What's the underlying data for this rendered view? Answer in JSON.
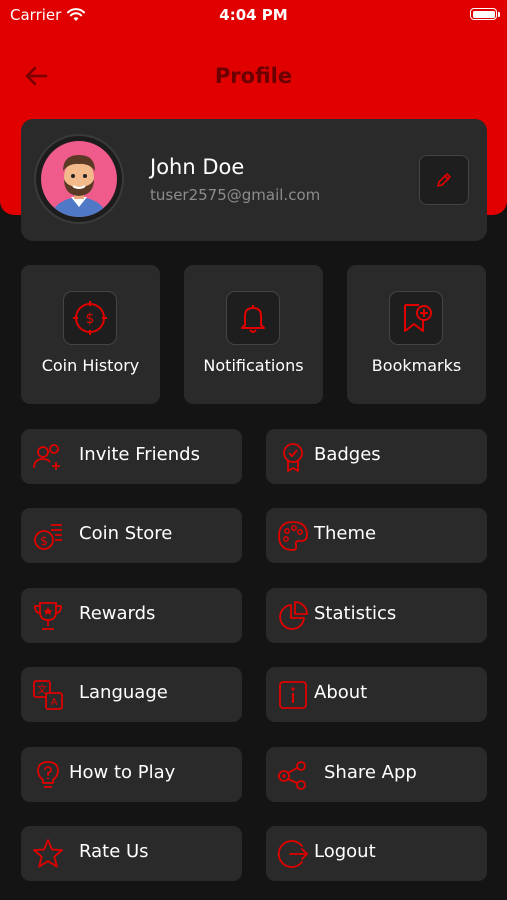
{
  "status_bar": {
    "carrier": "Carrier",
    "time": "4:04 PM"
  },
  "header": {
    "title": "Profile"
  },
  "profile": {
    "name": "John Doe",
    "email": "tuser2575@gmail.com"
  },
  "tiles": [
    {
      "label": "Coin History",
      "icon": "coin-history-icon"
    },
    {
      "label": "Notifications",
      "icon": "bell-icon"
    },
    {
      "label": "Bookmarks",
      "icon": "bookmark-icon"
    }
  ],
  "menu": [
    {
      "label": "Invite Friends",
      "icon": "invite-friends-icon"
    },
    {
      "label": "Badges",
      "icon": "badge-icon"
    },
    {
      "label": "Coin Store",
      "icon": "coin-store-icon"
    },
    {
      "label": "Theme",
      "icon": "palette-icon"
    },
    {
      "label": "Rewards",
      "icon": "trophy-icon"
    },
    {
      "label": "Statistics",
      "icon": "pie-chart-icon"
    },
    {
      "label": "Language",
      "icon": "language-icon"
    },
    {
      "label": "About",
      "icon": "info-icon"
    },
    {
      "label": "How to Play",
      "icon": "lightbulb-icon"
    },
    {
      "label": "Share App",
      "icon": "share-icon"
    },
    {
      "label": "Rate Us",
      "icon": "star-icon"
    },
    {
      "label": "Logout",
      "icon": "logout-icon"
    }
  ],
  "colors": {
    "accent": "#e00000",
    "card": "#2a2a2a",
    "background": "#141414",
    "title": "#6b0000"
  }
}
